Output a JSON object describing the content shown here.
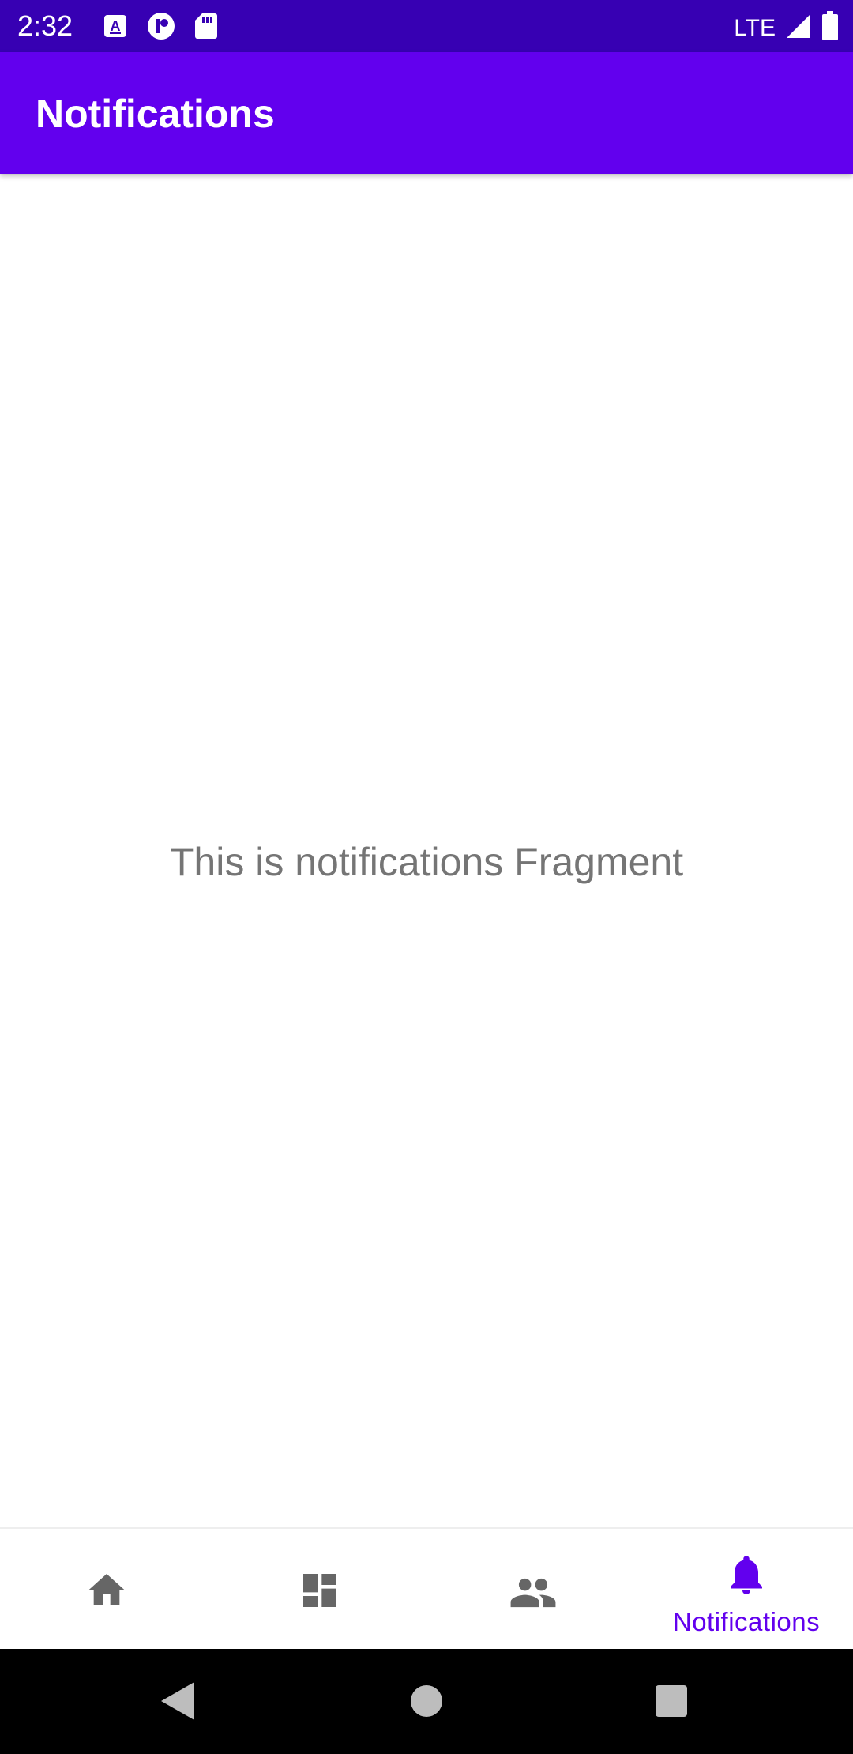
{
  "status_bar": {
    "time": "2:32",
    "network": "LTE",
    "icons_left": [
      "a-download-icon",
      "p-circle-icon",
      "sd-card-icon"
    ],
    "icons_right": [
      "signal-icon",
      "battery-icon"
    ],
    "background": "#3700b3"
  },
  "app_bar": {
    "title": "Notifications",
    "background": "#6200ee"
  },
  "content": {
    "message": "This is notifications Fragment"
  },
  "bottom_nav": {
    "items": [
      {
        "icon": "home-icon",
        "label": "",
        "active": false
      },
      {
        "icon": "dashboard-icon",
        "label": "",
        "active": false
      },
      {
        "icon": "people-icon",
        "label": "",
        "active": false
      },
      {
        "icon": "bell-icon",
        "label": "Notifications",
        "active": true
      }
    ],
    "active_color": "#6200ee",
    "inactive_color": "#666666"
  },
  "system_nav": {
    "buttons": [
      "back-icon",
      "home-circle-icon",
      "recents-icon"
    ]
  }
}
